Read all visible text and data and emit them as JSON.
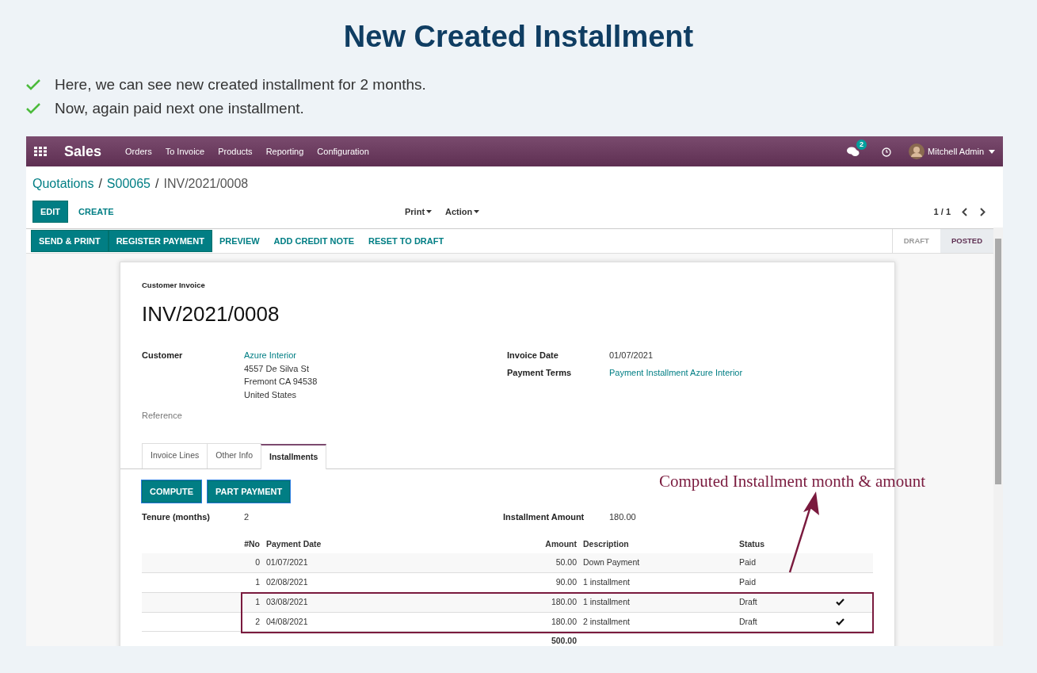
{
  "slide": {
    "title": "New Created Installment",
    "bullets": [
      "Here, we can see new created installment for 2 months.",
      "Now, again paid next one installment."
    ]
  },
  "navbar": {
    "app": "Sales",
    "menu": [
      "Orders",
      "To Invoice",
      "Products",
      "Reporting",
      "Configuration"
    ],
    "messages_badge": "2",
    "user": "Mitchell Admin"
  },
  "breadcrumb": [
    {
      "label": "Quotations",
      "kind": "link"
    },
    {
      "label": "/",
      "kind": "separator"
    },
    {
      "label": "S00065",
      "kind": "link"
    },
    {
      "label": "/",
      "kind": "separator"
    },
    {
      "label": "INV/2021/0008",
      "kind": "current"
    }
  ],
  "control_panel": {
    "buttons": [
      {
        "label": "EDIT",
        "kind": "primary"
      },
      {
        "label": "CREATE",
        "kind": "link"
      }
    ],
    "dropdowns": [
      "Print",
      "Action"
    ],
    "pager": "1 / 1"
  },
  "status_bar": {
    "buttons": [
      {
        "label": "SEND & PRINT",
        "kind": "primary"
      },
      {
        "label": "REGISTER PAYMENT",
        "kind": "primary"
      },
      {
        "label": "PREVIEW",
        "kind": "link"
      },
      {
        "label": "ADD CREDIT NOTE",
        "kind": "link"
      },
      {
        "label": "RESET TO DRAFT",
        "kind": "link"
      }
    ],
    "stages": [
      {
        "label": "DRAFT",
        "selected": false
      },
      {
        "label": "POSTED",
        "selected": true
      }
    ]
  },
  "invoice": {
    "type": "Customer Invoice",
    "number": "INV/2021/0008",
    "customer": {
      "label": "Customer",
      "name": "Azure Interior",
      "address": [
        "4557 De Silva St",
        "Fremont CA 94538",
        "United States"
      ]
    },
    "reference_label": "Reference",
    "fields": [
      {
        "label": "Invoice Date",
        "value": "01/07/2021",
        "kind": "text"
      },
      {
        "label": "Payment Terms",
        "value": "Payment Installment Azure Interior",
        "kind": "link"
      }
    ]
  },
  "tabs": [
    {
      "label": "Invoice Lines",
      "selected": false
    },
    {
      "label": "Other Info",
      "selected": false
    },
    {
      "label": "Installments",
      "selected": true
    }
  ],
  "installments": {
    "buttons": [
      "COMPUTE",
      "PART PAYMENT"
    ],
    "tenure_label": "Tenure (months)",
    "tenure": "2",
    "amount_label": "Installment Amount",
    "amount": "180.00",
    "columns": [
      "#No",
      "Payment Date",
      "Amount",
      "Description",
      "Status"
    ],
    "rows": [
      {
        "no": "0",
        "date": "01/07/2021",
        "amount": "50.00",
        "description": "Down Payment",
        "status": "Paid",
        "checked": false,
        "highlighted": false
      },
      {
        "no": "1",
        "date": "02/08/2021",
        "amount": "90.00",
        "description": "1 installment",
        "status": "Paid",
        "checked": false,
        "highlighted": false
      },
      {
        "no": "1",
        "date": "03/08/2021",
        "amount": "180.00",
        "description": "1 installment",
        "status": "Draft",
        "checked": true,
        "highlighted": true
      },
      {
        "no": "2",
        "date": "04/08/2021",
        "amount": "180.00",
        "description": "2 installment",
        "status": "Draft",
        "checked": true,
        "highlighted": true
      }
    ],
    "total": "500.00"
  },
  "annotation": "Computed Installment month & amount"
}
